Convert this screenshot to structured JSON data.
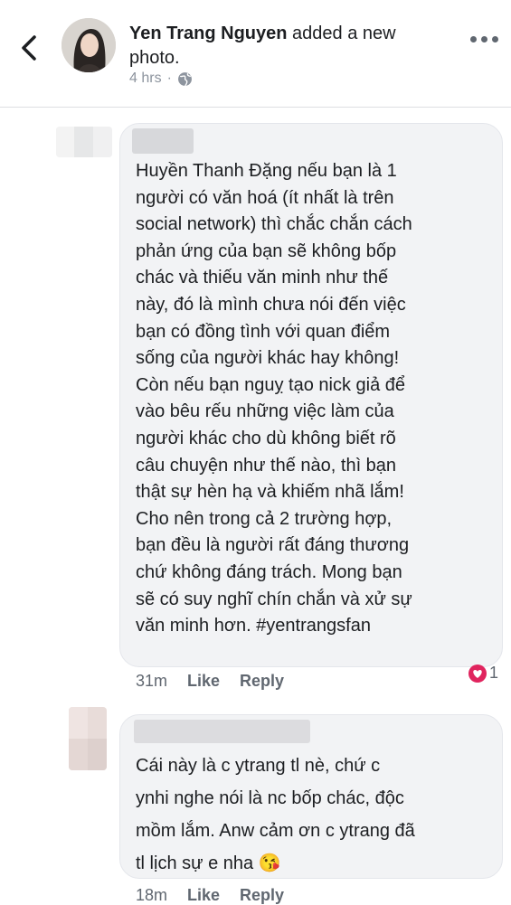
{
  "post": {
    "author": "Yen Trang Nguyen",
    "action": "added a new photo.",
    "time": "4 hrs",
    "audience_icon": "globe-icon"
  },
  "comments": [
    {
      "lines": [
        "Huyền Thanh Đặng nếu bạn là 1",
        "người có văn hoá (ít nhất là trên",
        "social network) thì chắc chắn cách",
        "phản ứng của bạn sẽ không bốp",
        "chác và thiếu văn minh như thế",
        "này, đó là mình chưa nói đến việc",
        "bạn có đồng tình với quan điểm",
        "sống của người khác hay không!",
        "Còn nếu bạn nguỵ tạo nick giả để",
        "vào bêu rếu những việc làm của",
        "người khác cho dù không biết rõ",
        "câu chuyện như thế nào, thì bạn",
        "thật sự hèn hạ và khiếm nhã lắm!",
        "Cho nên trong cả 2 trường hợp,",
        "bạn đều là người rất đáng thương",
        "chứ không đáng trách. Mong bạn",
        "sẽ có suy nghĩ chín chắn và xử sự",
        "văn minh hơn. #yentrangsfan"
      ],
      "time": "31m",
      "like": "Like",
      "reply": "Reply",
      "reaction_count": "1"
    },
    {
      "lines": [
        "Cái này là c ytrang tl nè, chứ c",
        "ynhi nghe nói là nc bốp chác, độc",
        "mồm lắm. Anw cảm ơn c ytrang đã",
        "tl lịch sự e nha 😘"
      ],
      "time": "18m",
      "like": "Like",
      "reply": "Reply"
    }
  ],
  "colors": {
    "like_accent": "#e0245e",
    "meta": "#8d949e",
    "bubble": "#f2f3f5"
  }
}
